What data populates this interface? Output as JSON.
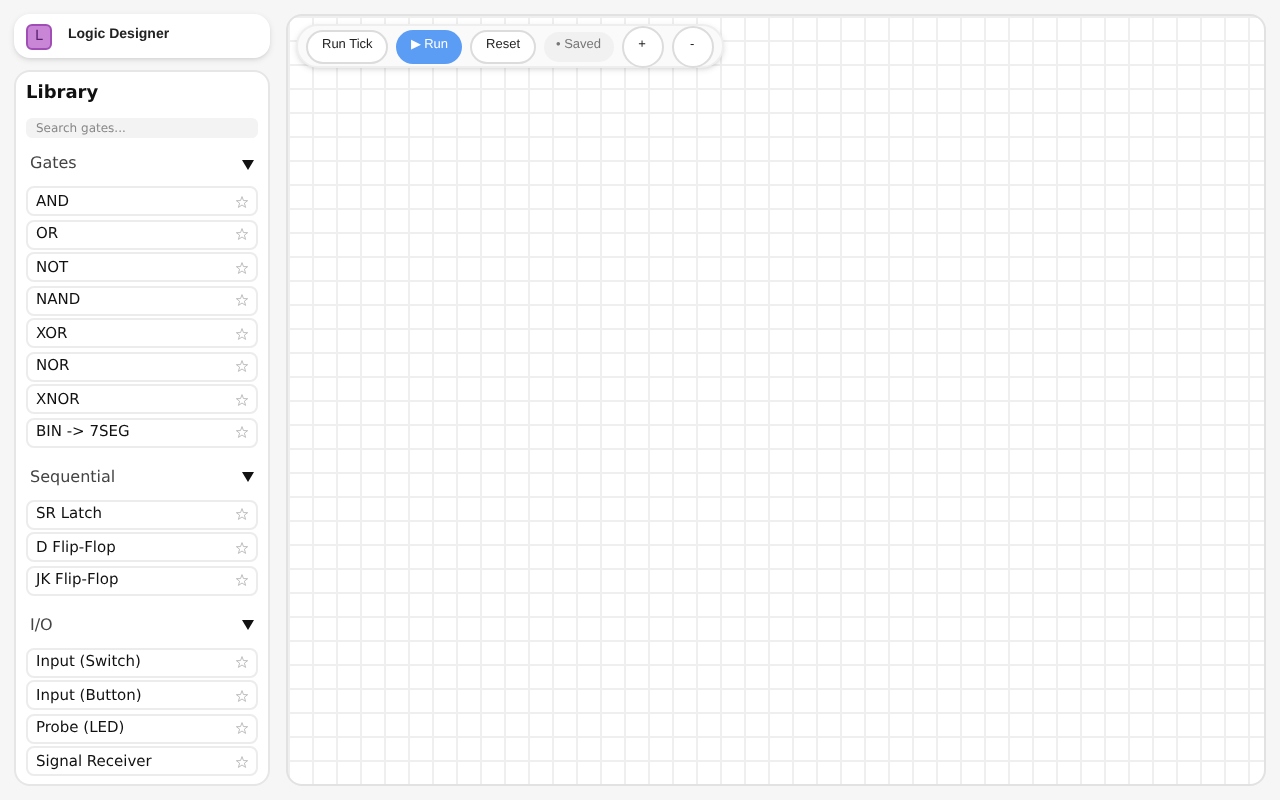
{
  "app": {
    "title": "Logic Designer",
    "logo_letter": "L"
  },
  "library": {
    "title": "Library",
    "search": {
      "placeholder": "Search gates..."
    },
    "sections": [
      {
        "title": "Gates",
        "expanded": true,
        "items": [
          "AND",
          "OR",
          "NOT",
          "NAND",
          "XOR",
          "NOR",
          "XNOR",
          "BIN -> 7SEG"
        ]
      },
      {
        "title": "Sequential",
        "expanded": true,
        "items": [
          "SR Latch",
          "D Flip-Flop",
          "JK Flip-Flop"
        ]
      },
      {
        "title": "I/O",
        "expanded": true,
        "items": [
          "Input (Switch)",
          "Input (Button)",
          "Probe (LED)",
          "Signal Receiver"
        ]
      }
    ]
  },
  "toolbar": [
    {
      "kind": "button",
      "label": "Run Tick"
    },
    {
      "kind": "primary",
      "label": "▶ Run"
    },
    {
      "kind": "button",
      "label": "Reset"
    },
    {
      "kind": "status",
      "label": "• Saved"
    },
    {
      "kind": "round",
      "label": "+"
    },
    {
      "kind": "round",
      "label": "-"
    }
  ]
}
